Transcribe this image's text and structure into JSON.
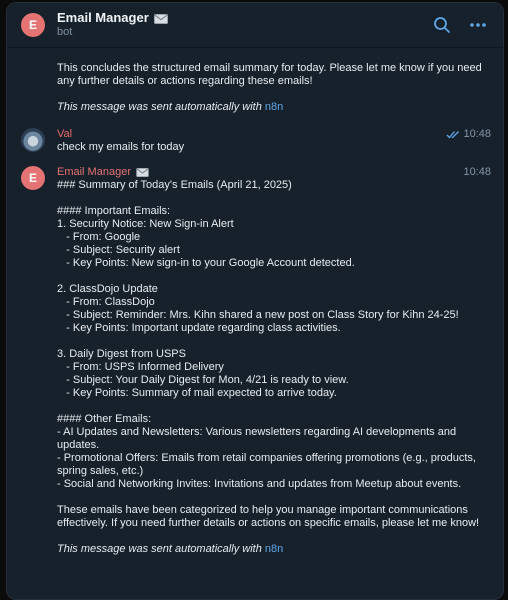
{
  "header": {
    "title": "Email Manager",
    "subtitle": "bot",
    "avatar_letter": "E"
  },
  "messages": [
    {
      "id": "bot-prev",
      "text": "This concludes the structured email summary for today. Please let me know if you need any further details or actions regarding these emails!",
      "footer_prefix": "This message was sent automatically with ",
      "footer_link": "n8n"
    },
    {
      "id": "user",
      "sender": "Val",
      "time": "10:48",
      "text": "check my emails for today"
    },
    {
      "id": "bot-main",
      "sender": "Email Manager",
      "avatar_letter": "E",
      "time": "10:48",
      "text": "### Summary of Today's Emails (April 21, 2025)\n\n#### Important Emails:\n1. Security Notice: New Sign-in Alert\n   - From: Google\n   - Subject: Security alert\n   - Key Points: New sign-in to your Google Account detected.\n\n2. ClassDojo Update\n   - From: ClassDojo\n   - Subject: Reminder: Mrs. Kihn shared a new post on Class Story for Kihn 24-25!\n   - Key Points: Important update regarding class activities.\n\n3. Daily Digest from USPS\n   - From: USPS Informed Delivery\n   - Subject: Your Daily Digest for Mon, 4/21 is ready to view.\n   - Key Points: Summary of mail expected to arrive today.\n\n#### Other Emails:\n- AI Updates and Newsletters: Various newsletters regarding AI developments and updates.\n- Promotional Offers: Emails from retail companies offering promotions (e.g., products, spring sales, etc.)\n- Social and Networking Invites: Invitations and updates from Meetup about events.\n\nThese emails have been categorized to help you manage important communications effectively. If you need further details or actions on specific emails, please let me know!",
      "footer_prefix": "This message was sent automatically with ",
      "footer_link": "n8n"
    }
  ],
  "icons": {
    "envelope": "envelope-icon",
    "search": "search-icon",
    "menu": "more-icon",
    "read": "double-check-icon"
  },
  "colors": {
    "background": "#17212b",
    "accent": "#5fa8e8",
    "bot_name": "#e57373",
    "avatar": "#e57373"
  }
}
